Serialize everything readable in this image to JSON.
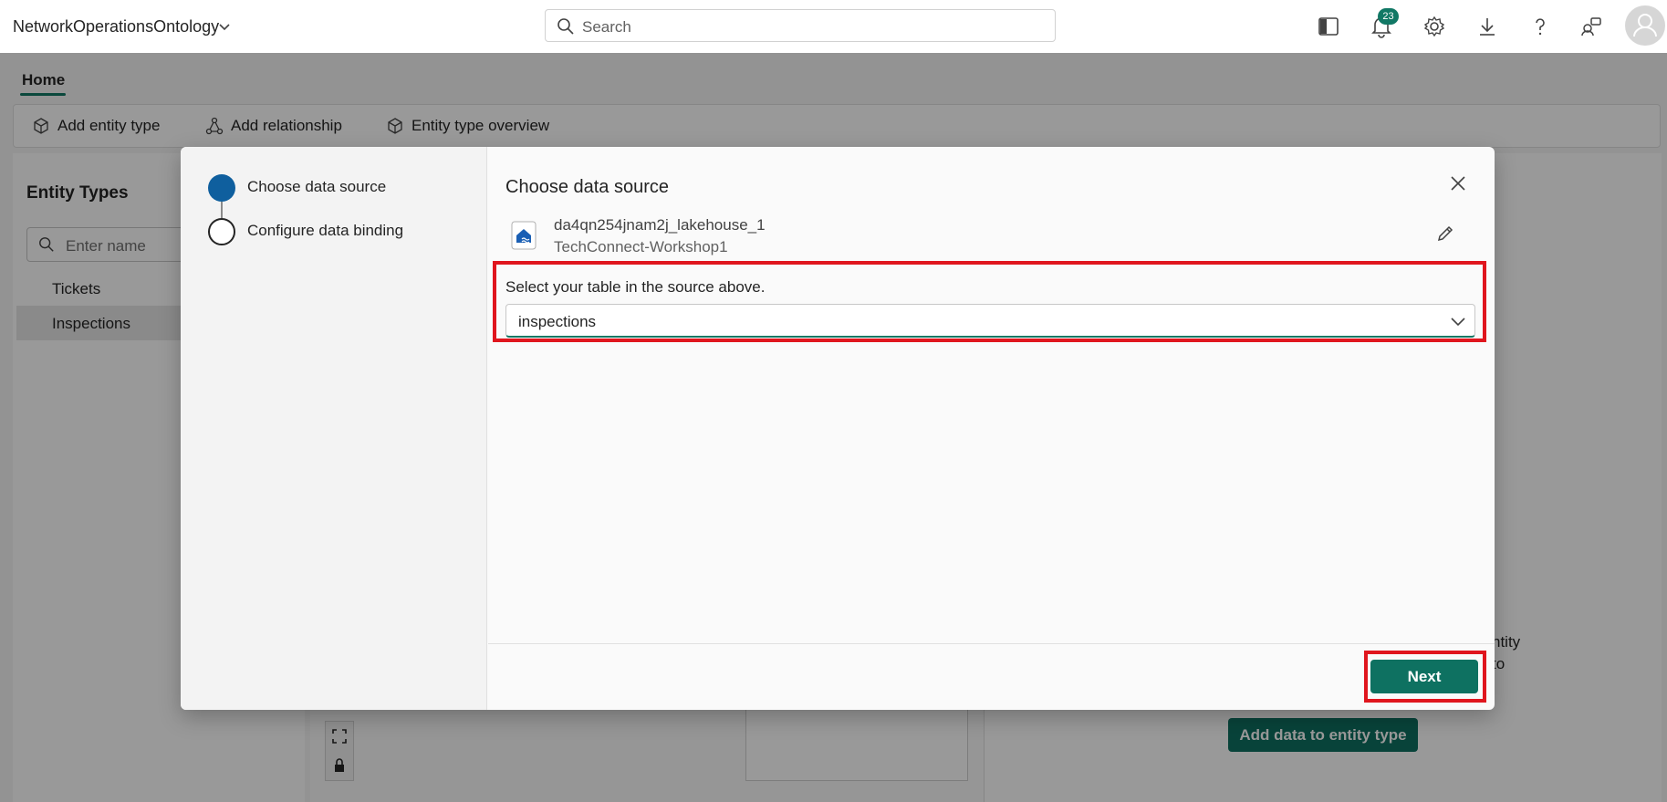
{
  "topbar": {
    "workspace_name": "NetworkOperationsOntology",
    "search_placeholder": "Search",
    "notification_count": "23",
    "icons": [
      "panel-toggle-icon",
      "bell-icon",
      "gear-icon",
      "download-icon",
      "help-icon",
      "share-feedback-icon",
      "user-avatar-icon"
    ]
  },
  "background": {
    "home_tab": "Home",
    "ribbon": {
      "add_entity_type": "Add entity type",
      "add_relationship": "Add relationship",
      "entity_type_overview": "Entity type overview"
    },
    "entity_types": {
      "title": "Entity Types",
      "search_placeholder": "Enter name",
      "items": [
        "Tickets",
        "Inspections"
      ]
    },
    "right_text_1": "ntity",
    "right_text_2": "to",
    "add_data_button": "Add data to entity type"
  },
  "dialog": {
    "steps": [
      {
        "label": "Choose data source",
        "state": "active"
      },
      {
        "label": "Configure data binding",
        "state": "pending"
      }
    ],
    "title": "Choose data source",
    "source": {
      "name": "da4qn254jnam2j_lakehouse_1",
      "workspace": "TechConnect-Workshop1"
    },
    "table_prompt": "Select your table in the source above.",
    "table_selected": "inspections",
    "next_button": "Next"
  },
  "colors": {
    "accent": "#117865",
    "primary_button": "#0e7161",
    "step_active": "#0f5f9e",
    "highlight": "#e0161e"
  }
}
